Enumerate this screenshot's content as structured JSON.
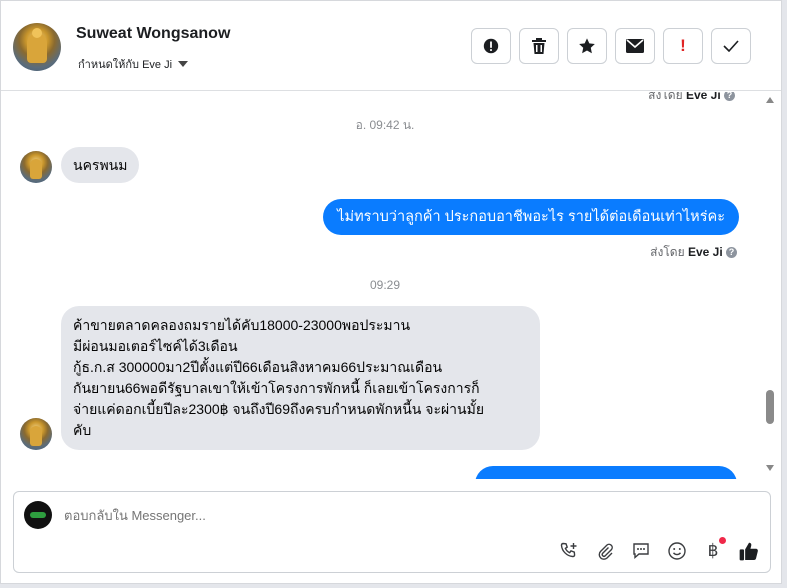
{
  "header": {
    "contact_name": "Suweat Wongsanow",
    "assigned_label": "กำหนดให้กับ Eve Ji"
  },
  "actions": [
    {
      "name": "spam-icon",
      "glyph": "❗"
    },
    {
      "name": "trash-icon",
      "glyph": "🗑"
    },
    {
      "name": "star-icon",
      "glyph": "★"
    },
    {
      "name": "mail-icon",
      "glyph": "✉"
    },
    {
      "name": "alert-icon",
      "glyph": "!"
    },
    {
      "name": "check-icon",
      "glyph": "✓"
    }
  ],
  "chat": {
    "top_sent_by_prefix": "ส่งโดย",
    "top_sent_by_name": "Eve Ji",
    "timestamp1": "อ. 09:42 น.",
    "msg_in_1": "นครพนม",
    "msg_out_1": "ไม่ทราบว่าลูกค้า ประกอบอาชีพอะไร รายได้ต่อเดือนเท่าไหร่คะ",
    "sent_by_prefix": "ส่งโดย",
    "sent_by_name": "Eve Ji",
    "timestamp2": "09:29",
    "msg_in_2_lines": [
      "ค้าขายตลาดคลองถมรายได้คับ18000-23000พอประมาน",
      "มีผ่อนมอเตอร์ไซค์ได้3เดือน",
      "กู้ธ.ก.ส 300000มา2ปีตั้งแต่ปี66เดือนสิงหาคม66ประมาณเดือน",
      "กันยายน66พอดีรัฐบาลเขาให้เข้าโครงการพักหนี้ ก็เลยเข้าโครงการก็",
      "จ่ายแค่ดอกเบี้ยปีละ2300฿ จนถึงปี69ถึงครบกำหนดพักหนี้น จะผ่านมั้ย",
      "คับ"
    ]
  },
  "composer": {
    "placeholder": "ตอบกลับใน Messenger..."
  },
  "colors": {
    "accent": "#0a7cff",
    "incoming_bubble": "#e4e6eb",
    "notification_dot": "#f02849"
  }
}
